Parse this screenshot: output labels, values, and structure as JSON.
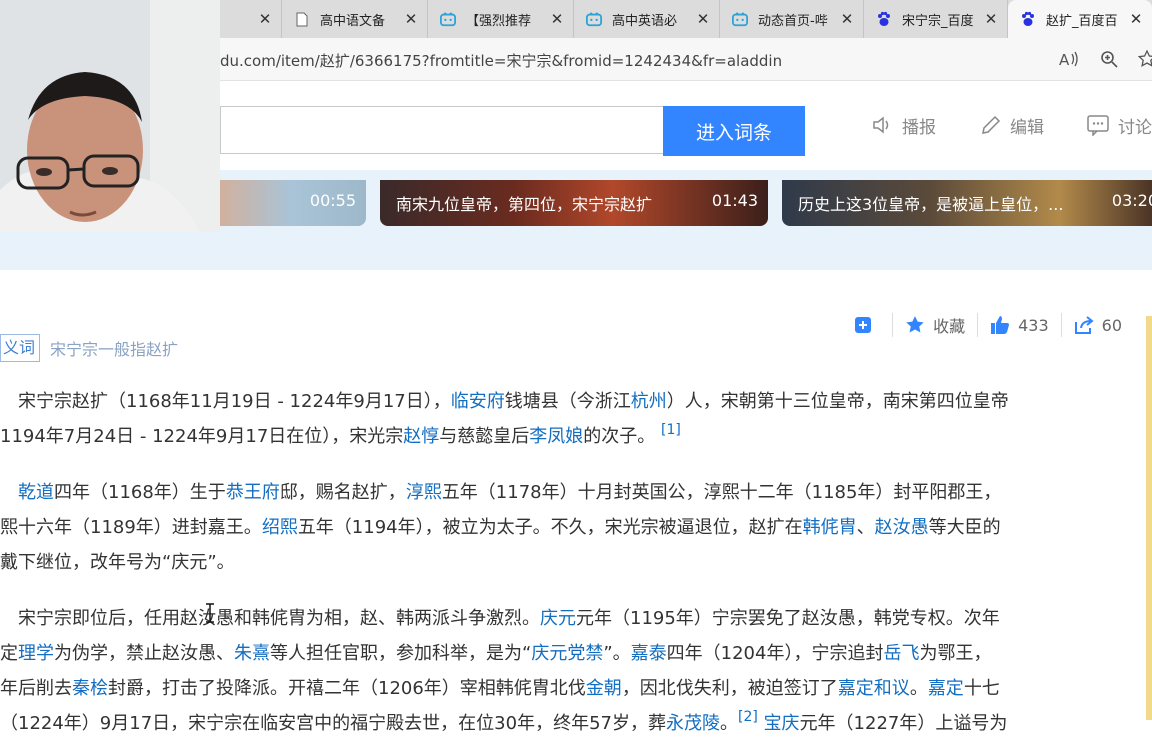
{
  "tabs": [
    {
      "title": "",
      "active": false,
      "icon": "partial-tab"
    },
    {
      "title": "高中语文备",
      "active": false,
      "icon": "document-icon"
    },
    {
      "title": "【强烈推荐",
      "active": false,
      "icon": "bilibili-icon"
    },
    {
      "title": "高中英语必",
      "active": false,
      "icon": "bilibili-icon"
    },
    {
      "title": "动态首页-哔",
      "active": false,
      "icon": "bilibili-icon"
    },
    {
      "title": "宋宁宗_百度",
      "active": false,
      "icon": "baidu-paw-icon"
    },
    {
      "title": "赵扩_百度百",
      "active": true,
      "icon": "baidu-paw-icon"
    }
  ],
  "address": {
    "url": "du.com/item/赵扩/6366175?fromtitle=宋宁宗&fromid=1242434&fr=aladdin"
  },
  "header": {
    "enter_button": "进入词条",
    "tools": [
      "播报",
      "编辑",
      "讨论"
    ],
    "search_value": ""
  },
  "videos": [
    {
      "title": "",
      "duration": "00:55"
    },
    {
      "title": "南宋九位皇帝，第四位，宋宁宗赵扩",
      "duration": "01:43"
    },
    {
      "title": "历史上这3位皇帝，是被逼上皇位，...",
      "duration": "03:20"
    }
  ],
  "actions": {
    "collect_label": "收藏",
    "like_count": "433",
    "share_count": "60"
  },
  "synonym": {
    "badge": "义词",
    "text": "宋宁宗一般指赵扩"
  },
  "colors": {
    "accent": "#3385ff",
    "link": "#136ec2",
    "video_strip": "#e8f2fb"
  },
  "article": {
    "p1": {
      "l1": [
        "宋宁宗赵扩（1168年11月19日 - 1224年9月17日），",
        "临安府",
        "钱塘县（今浙江",
        "杭州",
        "）人，宋朝第十三位皇帝，南宋第四位皇帝"
      ],
      "l2": [
        "1194年7月24日 - 1224年9月17日在位），宋光宗",
        "赵惇",
        "与慈懿皇后",
        "李凤娘",
        "的次子。",
        "[1]"
      ]
    },
    "p2": {
      "l1": [
        "乾道",
        "四年（1168年）生于",
        "恭王府",
        "邸，赐名赵扩，",
        "淳熙",
        "五年（1178年）十月封英国公，淳熙十二年（1185年）封平阳郡王，"
      ],
      "l2": [
        "熙十六年（1189年）进封嘉王。",
        "绍熙",
        "五年（1194年），被立为太子。不久，宋光宗被逼退位，赵扩在",
        "韩侂胄",
        "、",
        "赵汝愚",
        "等大臣的"
      ],
      "l3": [
        "戴下继位，改年号为“庆元”。"
      ]
    },
    "p3": {
      "l1": [
        "宋宁宗即位后，任用赵汝愚和韩侂胄为相，赵、韩两派斗争激烈。",
        "庆元",
        "元年（1195年）宁宗罢免了赵汝愚，韩党专权。次年"
      ],
      "l2": [
        "定",
        "理学",
        "为伪学，禁止赵汝愚、",
        "朱熹",
        "等人担任官职，参加科举，是为“",
        "庆元党禁",
        "”。",
        "嘉泰",
        "四年（1204年），宁宗追封",
        "岳飞",
        "为鄂王，"
      ],
      "l3": [
        "年后削去",
        "秦桧",
        "封爵，打击了投降派。开禧二年（1206年）宰相韩侂胄北伐",
        "金朝",
        "，因北伐失利，被迫签订了",
        "嘉定和议",
        "。",
        "嘉定",
        "十七"
      ],
      "l4": [
        "（1224年）9月17日，宋宁宗在临安宫中的福宁殿去世，在位30年，终年57岁，葬",
        "永茂陵",
        "。",
        "[2]",
        " ",
        "宝庆",
        "元年（1227年）上谥号为"
      ]
    }
  }
}
